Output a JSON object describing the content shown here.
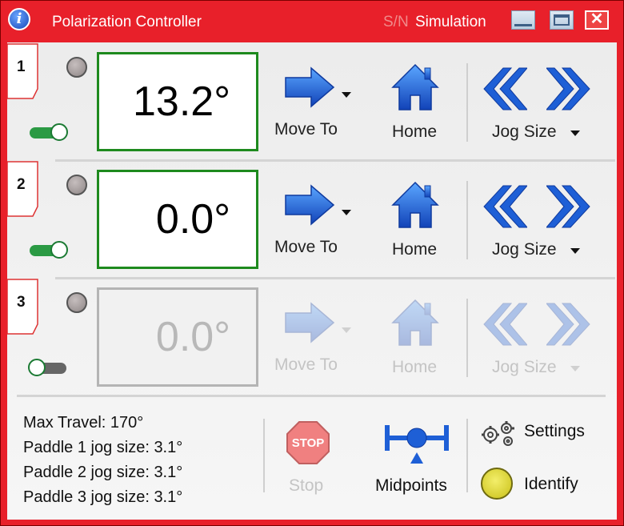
{
  "window": {
    "title": "Polarization Controller",
    "serial_label": "S/N",
    "serial_value": "Simulation",
    "accent_color": "#e8202a"
  },
  "paddles": [
    {
      "number": "1",
      "angle": "13.2°",
      "enabled": true,
      "move_label": "Move To",
      "home_label": "Home",
      "jog_label": "Jog Size"
    },
    {
      "number": "2",
      "angle": "0.0°",
      "enabled": true,
      "move_label": "Move To",
      "home_label": "Home",
      "jog_label": "Jog Size"
    },
    {
      "number": "3",
      "angle": "0.0°",
      "enabled": false,
      "move_label": "Move To",
      "home_label": "Home",
      "jog_label": "Jog Size"
    }
  ],
  "info": {
    "max_travel": "Max Travel: 170°",
    "paddle1_jog": "Paddle 1 jog size: 3.1°",
    "paddle2_jog": "Paddle 2 jog size: 3.1°",
    "paddle3_jog": "Paddle 3 jog size: 3.1°"
  },
  "actions": {
    "stop_label": "Stop",
    "stop_icon_text": "STOP",
    "midpoints_label": "Midpoints",
    "settings_label": "Settings",
    "identify_label": "Identify"
  },
  "icons": {
    "info": "info-icon",
    "move": "right-arrow-icon",
    "home": "house-icon",
    "jog_back": "double-chevron-left-icon",
    "jog_forward": "double-chevron-right-icon",
    "stop": "stop-sign-icon",
    "midpoints": "midpoint-icon",
    "settings": "gears-icon",
    "identify": "led-icon"
  },
  "colors": {
    "icon_blue": "#1e5fd6",
    "active_border": "#1e8a1e",
    "toggle_on": "#2b9a44"
  }
}
